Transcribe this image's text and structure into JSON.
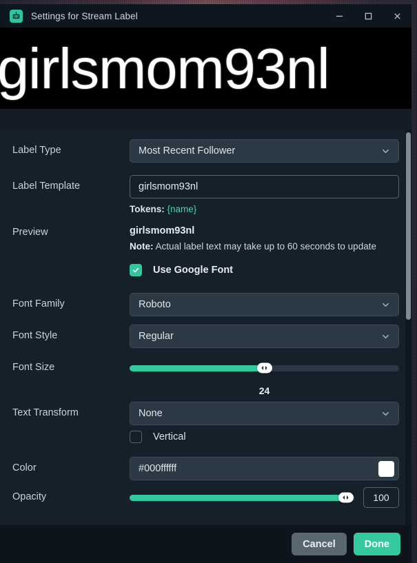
{
  "window": {
    "title": "Settings for Stream Label",
    "app_icon": "robot-icon",
    "controls": {
      "minimize": "minimize-icon",
      "maximize": "maximize-icon",
      "close": "close-icon"
    }
  },
  "preview_band": {
    "text": "girlsmom93nl"
  },
  "form": {
    "label_type": {
      "label": "Label Type",
      "value": "Most Recent Follower"
    },
    "label_template": {
      "label": "Label Template",
      "value": "girlsmom93nl",
      "tokens_prefix": "Tokens:",
      "tokens_value": "{name}"
    },
    "preview": {
      "label": "Preview",
      "value": "girlsmom93nl",
      "note_prefix": "Note:",
      "note_text": "Actual label text may take up to 60 seconds to update"
    },
    "use_google_font": {
      "label": "Use Google Font",
      "checked": true
    },
    "font_family": {
      "label": "Font Family",
      "value": "Roboto"
    },
    "font_style": {
      "label": "Font Style",
      "value": "Regular"
    },
    "font_size": {
      "label": "Font Size",
      "value": "24",
      "percent": 50
    },
    "text_transform": {
      "label": "Text Transform",
      "value": "None"
    },
    "vertical": {
      "label": "Vertical",
      "checked": false
    },
    "color": {
      "label": "Color",
      "value": "#000ffffff",
      "swatch": "#ffffff"
    },
    "opacity": {
      "label": "Opacity",
      "value": "100",
      "percent": 96
    }
  },
  "footer": {
    "cancel_label": "Cancel",
    "done_label": "Done"
  },
  "colors": {
    "accent": "#34c99f",
    "window_bg": "#16202b",
    "titlebar_bg": "#0e1620",
    "field_bg": "#2b3945"
  }
}
